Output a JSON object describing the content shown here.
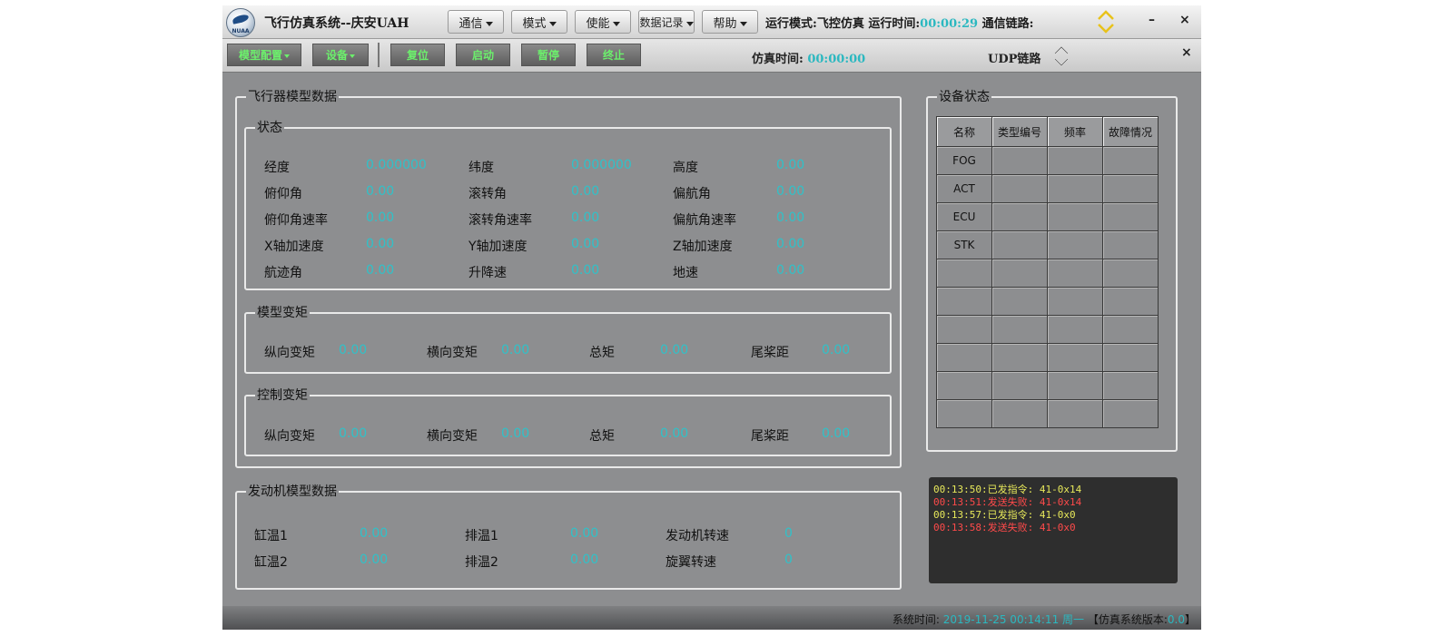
{
  "titlebar": {
    "title": "飞行仿真系统--庆安UAH",
    "menus": [
      "通信",
      "模式",
      "使能",
      "数据记录",
      "帮助"
    ],
    "run_mode_label": "运行模式:",
    "run_mode_value": "飞控仿真",
    "run_time_label": "运行时间:",
    "run_time_value": "00:00:29",
    "link_label": "通信链路:",
    "minimize_glyph": "–",
    "close_glyph": "×"
  },
  "toolbar": {
    "model_config": "模型配置",
    "device": "设备",
    "reset": "复位",
    "start": "启动",
    "pause": "暂停",
    "stop": "终止",
    "sim_time_label": "仿真时间:",
    "sim_time_value": "00:00:00",
    "udp_label": "UDP链路",
    "close_glyph": "×"
  },
  "aircraft": {
    "title": "飞行器模型数据",
    "state": {
      "title": "状态",
      "rows": [
        [
          {
            "label": "经度",
            "value": "0.000000"
          },
          {
            "label": "纬度",
            "value": "0.000000"
          },
          {
            "label": "高度",
            "value": "0.00"
          }
        ],
        [
          {
            "label": "俯仰角",
            "value": "0.00"
          },
          {
            "label": "滚转角",
            "value": "0.00"
          },
          {
            "label": "偏航角",
            "value": "0.00"
          }
        ],
        [
          {
            "label": "俯仰角速率",
            "value": "0.00"
          },
          {
            "label": "滚转角速率",
            "value": "0.00"
          },
          {
            "label": "偏航角速率",
            "value": "0.00"
          }
        ],
        [
          {
            "label": "X轴加速度",
            "value": "0.00"
          },
          {
            "label": "Y轴加速度",
            "value": "0.00"
          },
          {
            "label": "Z轴加速度",
            "value": "0.00"
          }
        ],
        [
          {
            "label": "航迹角",
            "value": "0.00"
          },
          {
            "label": "升降速",
            "value": "0.00"
          },
          {
            "label": "地速",
            "value": "0.00"
          }
        ]
      ]
    },
    "model_torque": {
      "title": "模型变矩",
      "items": [
        {
          "label": "纵向变矩",
          "value": "0.00"
        },
        {
          "label": "横向变矩",
          "value": "0.00"
        },
        {
          "label": "总矩",
          "value": "0.00"
        },
        {
          "label": "尾桨距",
          "value": "0.00"
        }
      ]
    },
    "control_torque": {
      "title": "控制变矩",
      "items": [
        {
          "label": "纵向变矩",
          "value": "0.00"
        },
        {
          "label": "横向变矩",
          "value": "0.00"
        },
        {
          "label": "总矩",
          "value": "0.00"
        },
        {
          "label": "尾桨距",
          "value": "0.00"
        }
      ]
    }
  },
  "engine": {
    "title": "发动机模型数据",
    "rows": [
      [
        {
          "label": "缸温1",
          "value": "0.00"
        },
        {
          "label": "排温1",
          "value": "0.00"
        },
        {
          "label": "发动机转速",
          "value": "0"
        }
      ],
      [
        {
          "label": "缸温2",
          "value": "0.00"
        },
        {
          "label": "排温2",
          "value": "0.00"
        },
        {
          "label": "旋翼转速",
          "value": "0"
        }
      ]
    ]
  },
  "devices": {
    "title": "设备状态",
    "columns": [
      "名称",
      "类型编号",
      "频率",
      "故障情况"
    ],
    "rows": [
      "FOG",
      "ACT",
      "ECU",
      "STK",
      "",
      "",
      "",
      "",
      "",
      ""
    ]
  },
  "log": [
    {
      "time": "00:13:50:",
      "text": "已发指令: 41-0x14",
      "status": "ok"
    },
    {
      "time": "00:13:51:",
      "text": "发送失败: 41-0x14",
      "status": "err"
    },
    {
      "time": "00:13:57:",
      "text": "已发指令: 41-0x0",
      "status": "ok"
    },
    {
      "time": "00:13:58:",
      "text": "发送失败: 41-0x0",
      "status": "err"
    }
  ],
  "statusbar": {
    "sys_time_label": "系统时间:",
    "sys_time_value": "2019-11-25 00:14:11 周一",
    "version_label": "【仿真系统版本:",
    "version_value": "0.0",
    "version_close": "】"
  },
  "colors": {
    "value_cyan": "#2fc2c9",
    "toolbar_green": "#6cf06c",
    "log_ok": "#e7e85a",
    "log_err": "#ff4a4a"
  }
}
